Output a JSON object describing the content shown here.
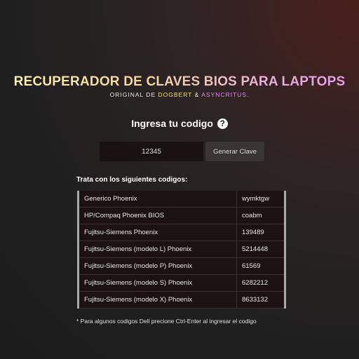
{
  "header": {
    "title": "RECUPERADOR DE CLAVES BIOS PARA LAPTOPS",
    "subtitle_prefix": "ORIGINAL DE",
    "author1": "DOGBERT",
    "amp": "&",
    "author2": "ASYNCRITUS."
  },
  "form": {
    "prompt": "Ingresa tu codigo",
    "help_icon": "?",
    "code_value": "12345",
    "generate_label": "Generar Clave"
  },
  "list": {
    "heading": "Trata con los siguientes codigos:",
    "rows": [
      {
        "name": "Generico Phoenix",
        "key": "wymktgw"
      },
      {
        "name": "HP/Compaq Phoenix BIOS",
        "key": "coabm"
      },
      {
        "name": "Fujitsu-Siemens Phoenix",
        "key": "139489"
      },
      {
        "name": "Fujitsu-Siemens (modelo L) Phoenix",
        "key": "5214448"
      },
      {
        "name": "Fujitsu-Siemens (modelo P) Phoenix",
        "key": "61569"
      },
      {
        "name": "Fujitsu-Siemens (modelo S) Phoenix",
        "key": "6282212"
      },
      {
        "name": "Fujitsu-Siemens (modelo X) Phoenix",
        "key": "8633132"
      }
    ]
  },
  "footer": {
    "note": "* Para algunos codigos Dell precione Ctrl-Enter al ingresar el codigo"
  },
  "colors": {
    "author1": "#f4e26c",
    "author2": "#e28be9"
  }
}
